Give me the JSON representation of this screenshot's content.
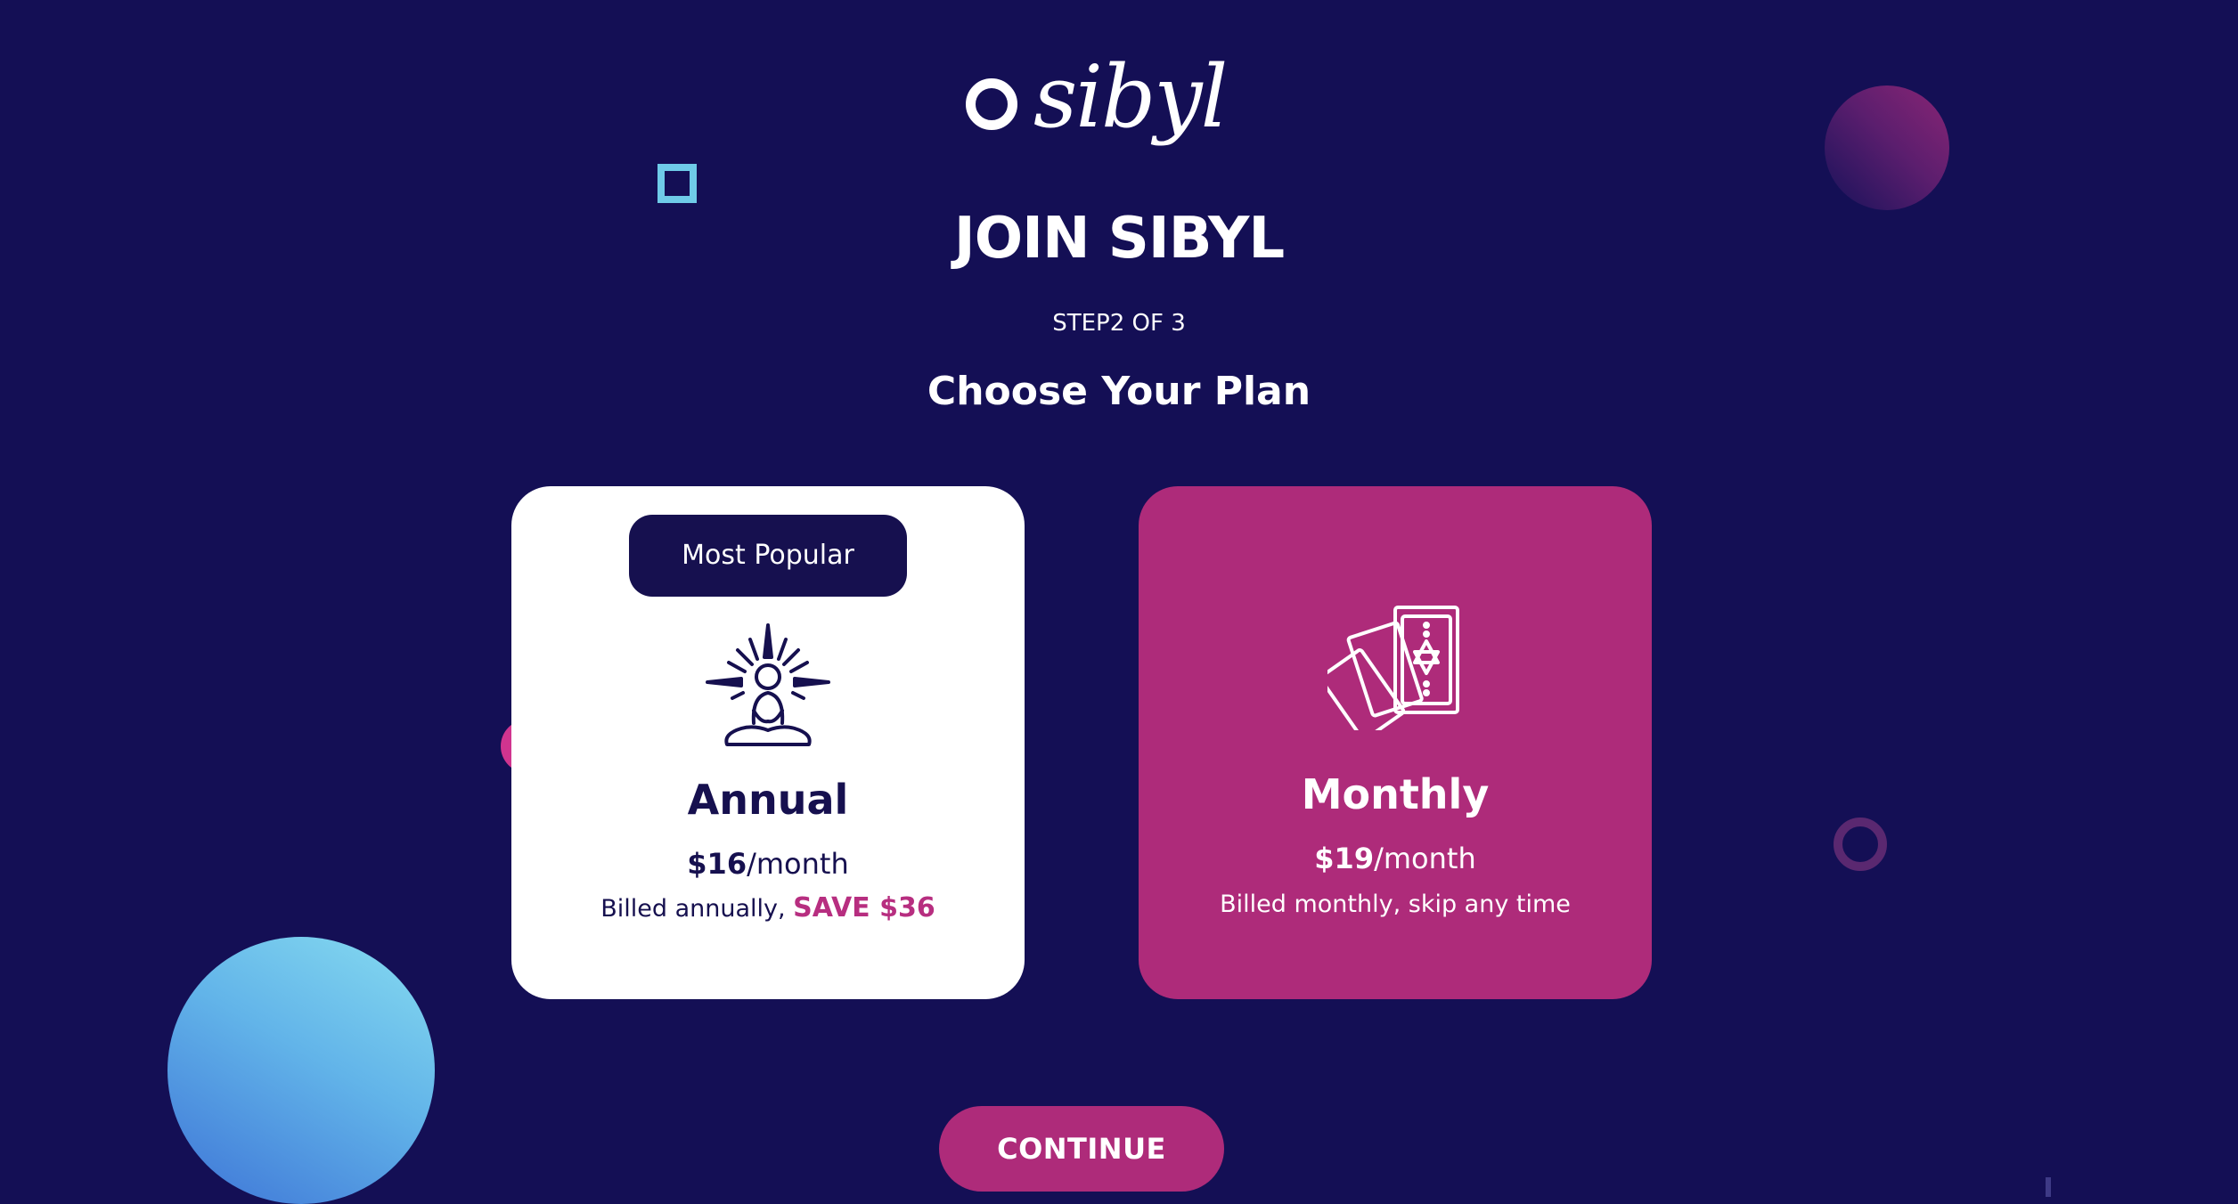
{
  "logo": {
    "text": "sibyl"
  },
  "header": {
    "title": "JOIN SIBYL",
    "step": "STEP2 OF 3",
    "subtitle": "Choose Your Plan"
  },
  "plans": [
    {
      "badge": "Most Popular",
      "icon": "meditation-icon",
      "name": "Annual",
      "price": "$16",
      "period": "/month",
      "billing_prefix": "Billed annually, ",
      "savings": "SAVE $36",
      "selected": true
    },
    {
      "icon": "tarot-cards-icon",
      "name": "Monthly",
      "price": "$19",
      "period": "/month",
      "billing": "Billed monthly, skip any time",
      "selected": false
    }
  ],
  "actions": {
    "continue_label": "CONTINUE"
  },
  "colors": {
    "background": "#140f55",
    "accent": "#ae2b7a",
    "card_light": "#ffffff",
    "navy": "#16104f",
    "cyan": "#6fcbe8"
  }
}
